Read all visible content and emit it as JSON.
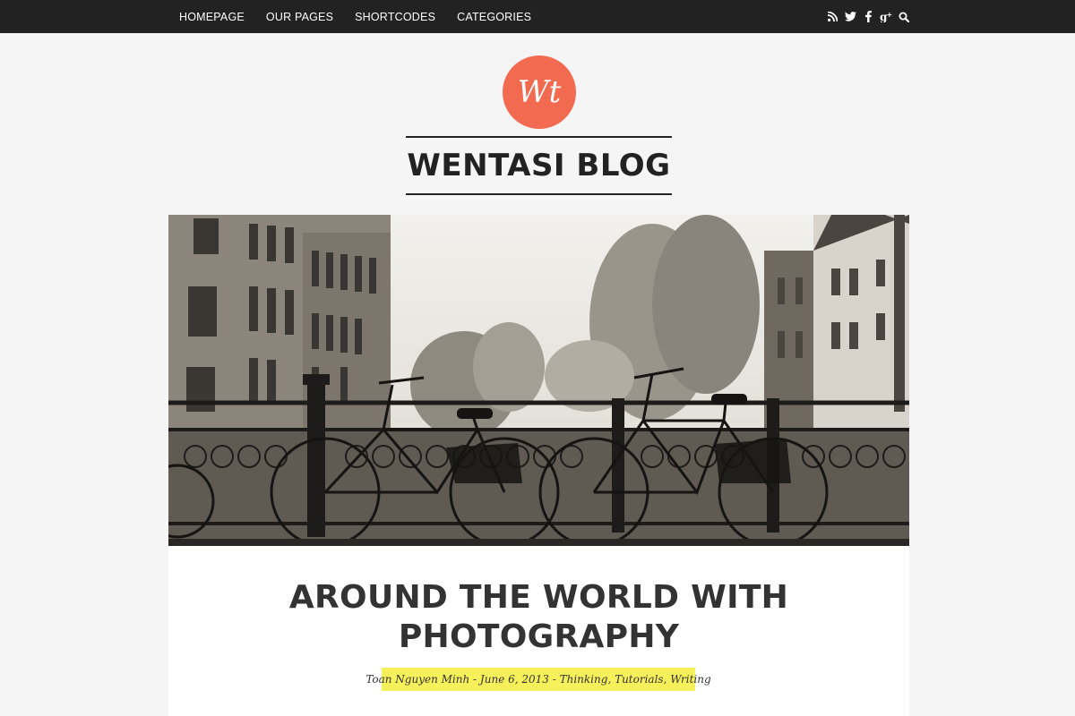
{
  "nav": {
    "items": [
      "HOMEPAGE",
      "OUR PAGES",
      "SHORTCODES",
      "CATEGORIES"
    ],
    "social_icons": [
      "rss-icon",
      "twitter-icon",
      "facebook-icon",
      "google-plus-icon",
      "search-icon"
    ]
  },
  "brand": {
    "logo_text": "Wt",
    "title": "WENTASI BLOG",
    "accent": "#f26a50"
  },
  "post": {
    "title_line1": "AROUND THE WORLD WITH",
    "title_line2": "PHOTOGRAPHY",
    "author": "Toan Nguyen Minh",
    "date": "June 6, 2013",
    "categories": [
      "Thinking",
      "Tutorials",
      "Writing"
    ],
    "meta_highlight": "#f6f15a"
  }
}
